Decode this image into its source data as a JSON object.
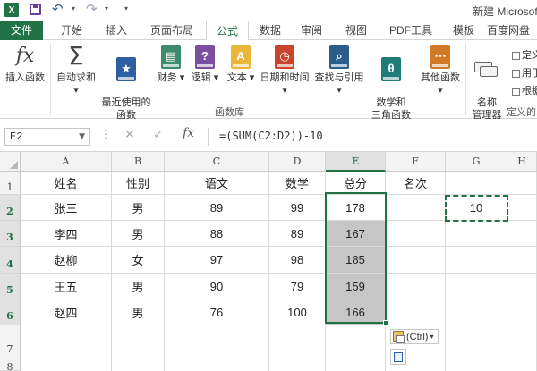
{
  "titlebar": {
    "app_icon_letter": "X",
    "title": "新建 Microsoft"
  },
  "tabs": [
    "文件",
    "开始",
    "插入",
    "页面布局",
    "公式",
    "数据",
    "审阅",
    "视图",
    "PDF工具",
    "模板",
    "百度网盘"
  ],
  "active_tab": "公式",
  "ribbon": {
    "buttons": [
      {
        "label": "插入函数",
        "icon": "fx-icon"
      },
      {
        "label": "自动求和",
        "icon": "sigma-icon",
        "dropdown": true
      },
      {
        "label": "最近使用的\n函数",
        "icon": "star-book-icon",
        "dropdown": true
      },
      {
        "label": "财务",
        "icon": "finance-book-icon",
        "dropdown": true
      },
      {
        "label": "逻辑",
        "icon": "logic-book-icon",
        "dropdown": true
      },
      {
        "label": "文本",
        "icon": "text-book-icon",
        "dropdown": true
      },
      {
        "label": "日期和时间",
        "icon": "datetime-book-icon",
        "dropdown": true
      },
      {
        "label": "查找与引用",
        "icon": "lookup-book-icon",
        "dropdown": true
      },
      {
        "label": "数学和\n三角函数",
        "icon": "math-book-icon",
        "dropdown": true
      },
      {
        "label": "其他函数",
        "icon": "other-book-icon",
        "dropdown": true
      },
      {
        "label": "名称\n管理器",
        "icon": "name-manager-icon"
      }
    ],
    "right_small_buttons": [
      "定义",
      "用于",
      "根据"
    ],
    "group_library": "函数库",
    "group_defined_names": "定义的"
  },
  "formula_bar": {
    "name_box": "E2",
    "fx_label": "fx",
    "formula": "=(SUM(C2:D2))-10"
  },
  "columns": [
    "A",
    "B",
    "C",
    "D",
    "E",
    "F",
    "G",
    "H"
  ],
  "selected_column": "E",
  "rows": [
    "1",
    "2",
    "3",
    "4",
    "5",
    "6",
    "7",
    "8"
  ],
  "selected_rows": [
    "2",
    "3",
    "4",
    "5",
    "6"
  ],
  "table": {
    "headers": [
      "姓名",
      "性别",
      "语文",
      "数学",
      "总分",
      "名次"
    ],
    "data": [
      [
        "张三",
        "男",
        "89",
        "99",
        "178"
      ],
      [
        "李四",
        "男",
        "88",
        "89",
        "167"
      ],
      [
        "赵柳",
        "女",
        "97",
        "98",
        "185"
      ],
      [
        "王五",
        "男",
        "90",
        "79",
        "159"
      ],
      [
        "赵四",
        "男",
        "76",
        "100",
        "166"
      ]
    ],
    "g2_value": "10"
  },
  "paste_options_label": "(Ctrl)",
  "colors": {
    "excel_green": "#217346",
    "selected_fill": "#c6c6c6"
  }
}
